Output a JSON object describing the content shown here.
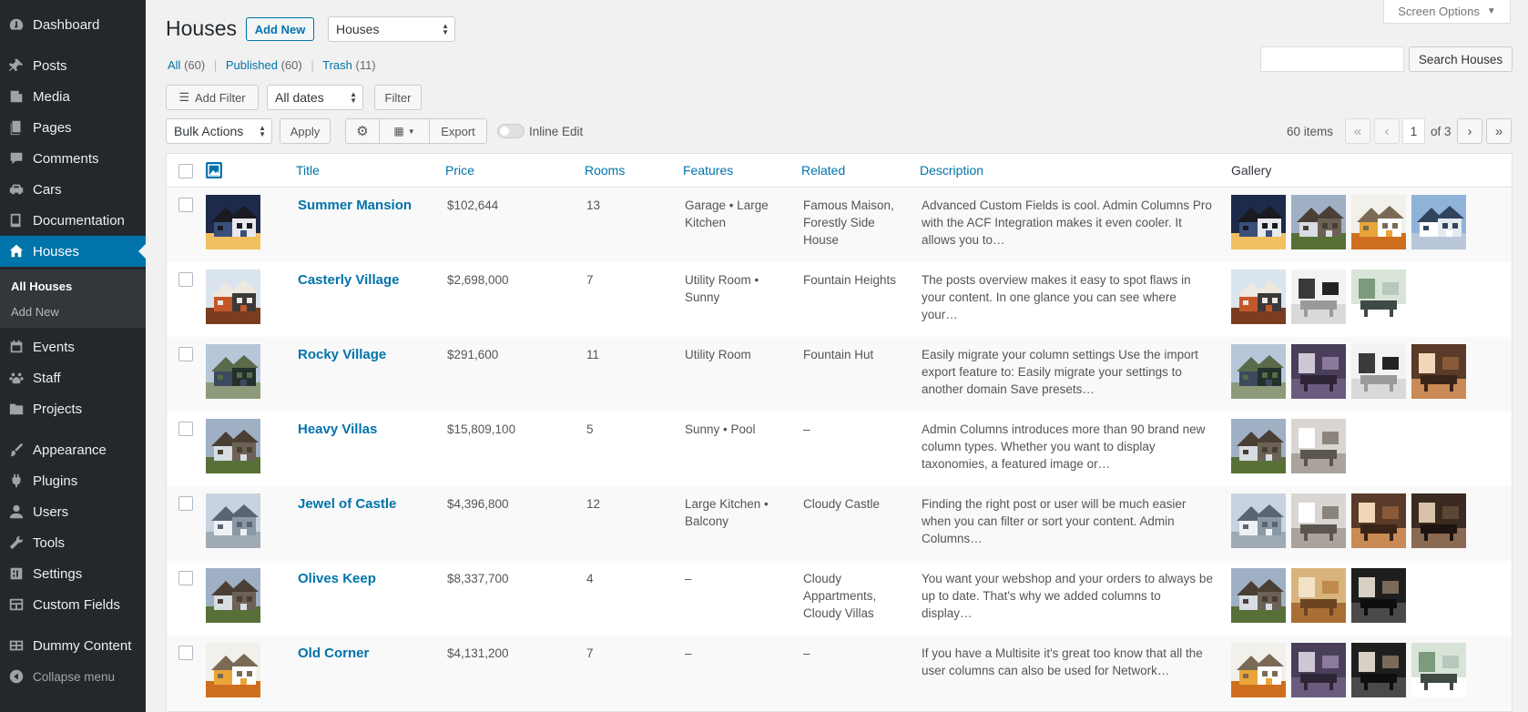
{
  "sidebar": {
    "dashboard": "Dashboard",
    "posts": "Posts",
    "media": "Media",
    "pages": "Pages",
    "comments": "Comments",
    "cars": "Cars",
    "documentation": "Documentation",
    "houses": "Houses",
    "all_houses": "All Houses",
    "add_new": "Add New",
    "events": "Events",
    "staff": "Staff",
    "projects": "Projects",
    "appearance": "Appearance",
    "plugins": "Plugins",
    "users": "Users",
    "tools": "Tools",
    "settings": "Settings",
    "custom_fields": "Custom Fields",
    "dummy_content": "Dummy Content",
    "collapse": "Collapse menu"
  },
  "header": {
    "title": "Houses",
    "add_new": "Add New",
    "view_select": "Houses",
    "screen_options": "Screen Options"
  },
  "views": {
    "all": "All",
    "all_count": "(60)",
    "published": "Published",
    "published_count": "(60)",
    "trash": "Trash",
    "trash_count": "(11)"
  },
  "search": {
    "button": "Search Houses",
    "value": ""
  },
  "filters": {
    "add_filter": "Add Filter",
    "dates": "All dates",
    "filter_button": "Filter"
  },
  "bulk": {
    "actions": "Bulk Actions",
    "apply": "Apply",
    "export": "Export",
    "inline_edit": "Inline Edit"
  },
  "pagination": {
    "items": "60 items",
    "first": "«",
    "prev": "‹",
    "current": "1",
    "of": "of 3",
    "next": "›",
    "last": "»"
  },
  "columns": {
    "title": "Title",
    "price": "Price",
    "rooms": "Rooms",
    "features": "Features",
    "related": "Related",
    "description": "Description",
    "gallery": "Gallery"
  },
  "rows": [
    {
      "title": "Summer Mansion",
      "price": "$102,644",
      "rooms": "13",
      "features": "Garage • Large Kitchen",
      "related": "Famous Maison, Forestly Side House",
      "description": "Advanced Custom Fields is cool. Admin Columns Pro with the ACF Integration makes it even cooler. It allows you to…",
      "thumb": "house-blue-dusk",
      "gallery": [
        "house-blue-dusk",
        "house-grey-gable",
        "house-autumn-tree",
        "house-white-modern"
      ]
    },
    {
      "title": "Casterly Village",
      "price": "$2,698,000",
      "rooms": "7",
      "features": "Utility Room • Sunny",
      "related": "Fountain Heights",
      "description": "The posts overview makes it easy to spot flaws in your content. In one glance you can see where your…",
      "thumb": "house-modern-orange",
      "gallery": [
        "house-modern-orange",
        "interior-dining-white",
        "interior-glass-room"
      ]
    },
    {
      "title": "Rocky Village",
      "price": "$291,600",
      "rooms": "11",
      "features": "Utility Room",
      "related": "Fountain Hut",
      "description": "Easily migrate your column settings Use the import export feature to: Easily migrate your settings to another domain Save presets…",
      "thumb": "house-dark-trees",
      "gallery": [
        "house-dark-trees",
        "interior-purple-living",
        "interior-dining-white",
        "interior-warm-lounge"
      ]
    },
    {
      "title": "Heavy Villas",
      "price": "$15,809,100",
      "rooms": "5",
      "features": "Sunny • Pool",
      "related": "–",
      "description": "Admin Columns introduces more than 90 brand new column types. Whether you want to display taxonomies, a featured image or…",
      "thumb": "house-grey-gable",
      "gallery": [
        "house-grey-gable",
        "interior-loft-stairs"
      ]
    },
    {
      "title": "Jewel of Castle",
      "price": "$4,396,800",
      "rooms": "12",
      "features": "Large Kitchen • Balcony",
      "related": "Cloudy Castle",
      "description": "Finding the right post or user will be much easier when you can filter or sort your content. Admin Columns…",
      "thumb": "house-white-porch",
      "gallery": [
        "house-white-porch",
        "interior-loft-stairs",
        "interior-warm-lounge",
        "interior-dark-bedroom"
      ]
    },
    {
      "title": "Olives Keep",
      "price": "$8,337,700",
      "rooms": "4",
      "features": "–",
      "related": "Cloudy Appartments, Cloudy Villas",
      "description": "You want your webshop and your orders to always be up to date. That's why we added columns to display…",
      "thumb": "house-grey-gable",
      "gallery": [
        "house-grey-gable",
        "interior-wood-kitchen",
        "interior-black-modern"
      ]
    },
    {
      "title": "Old Corner",
      "price": "$4,131,200",
      "rooms": "7",
      "features": "–",
      "related": "–",
      "description": "If you have a Multisite it's great too know that all the user columns can also be used for Network…",
      "thumb": "house-autumn-tree",
      "gallery": [
        "house-autumn-tree",
        "interior-purple-living",
        "interior-black-modern",
        "interior-glass-room"
      ]
    }
  ],
  "colors": {
    "accent": "#0073aa",
    "sidebar_bg": "#23282d",
    "active_bg": "#0073aa"
  }
}
